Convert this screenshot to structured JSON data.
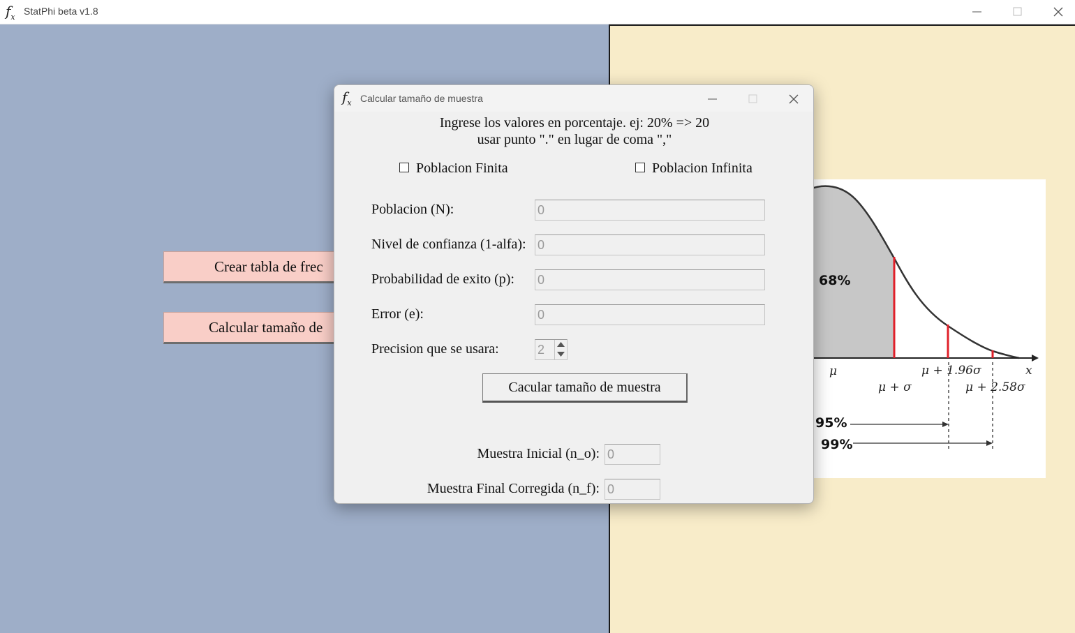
{
  "main_window": {
    "title": "StatPhi beta v1.8",
    "icon": "function-icon"
  },
  "left_panel": {
    "background": "#9eaec8",
    "buttons": [
      {
        "label": "Crear tabla de frec"
      },
      {
        "label": "Calcular tamaño de"
      }
    ]
  },
  "right_panel": {
    "background": "#f8ecc9",
    "chart_image": {
      "labels": {
        "mu": "μ",
        "mu_sigma": "μ + σ",
        "mu_196": "μ + 1.96σ",
        "mu_258": "μ + 2.58σ",
        "x": "x",
        "p68": "68%",
        "p95": "95%",
        "p99": "99%"
      }
    }
  },
  "dialog": {
    "title": "Calcular tamaño de muestra",
    "icon": "function-icon",
    "instruction_line1": "Ingrese los valores en porcentaje. ej: 20% => 20",
    "instruction_line2": "usar punto \".\" en lugar de coma \",\"",
    "checkboxes": {
      "finita": {
        "label": "Poblacion Finita",
        "checked": false
      },
      "infinita": {
        "label": "Poblacion Infinita",
        "checked": false
      }
    },
    "fields": {
      "poblacion": {
        "label": "Poblacion (N):",
        "value": "0"
      },
      "nivel": {
        "label": "Nivel de confianza (1-alfa):",
        "value": "0"
      },
      "probabilidad": {
        "label": "Probabilidad de exito (p):",
        "value": "0"
      },
      "error": {
        "label": "Error (e):",
        "value": "0"
      }
    },
    "precision": {
      "label": "Precision que se usara:",
      "value": "2"
    },
    "calc_button": "Cacular tamaño de muestra",
    "results": {
      "inicial": {
        "label": "Muestra Inicial (n_o):",
        "value": "0"
      },
      "final": {
        "label": "Muestra Final Corregida (n_f):",
        "value": "0"
      }
    }
  }
}
